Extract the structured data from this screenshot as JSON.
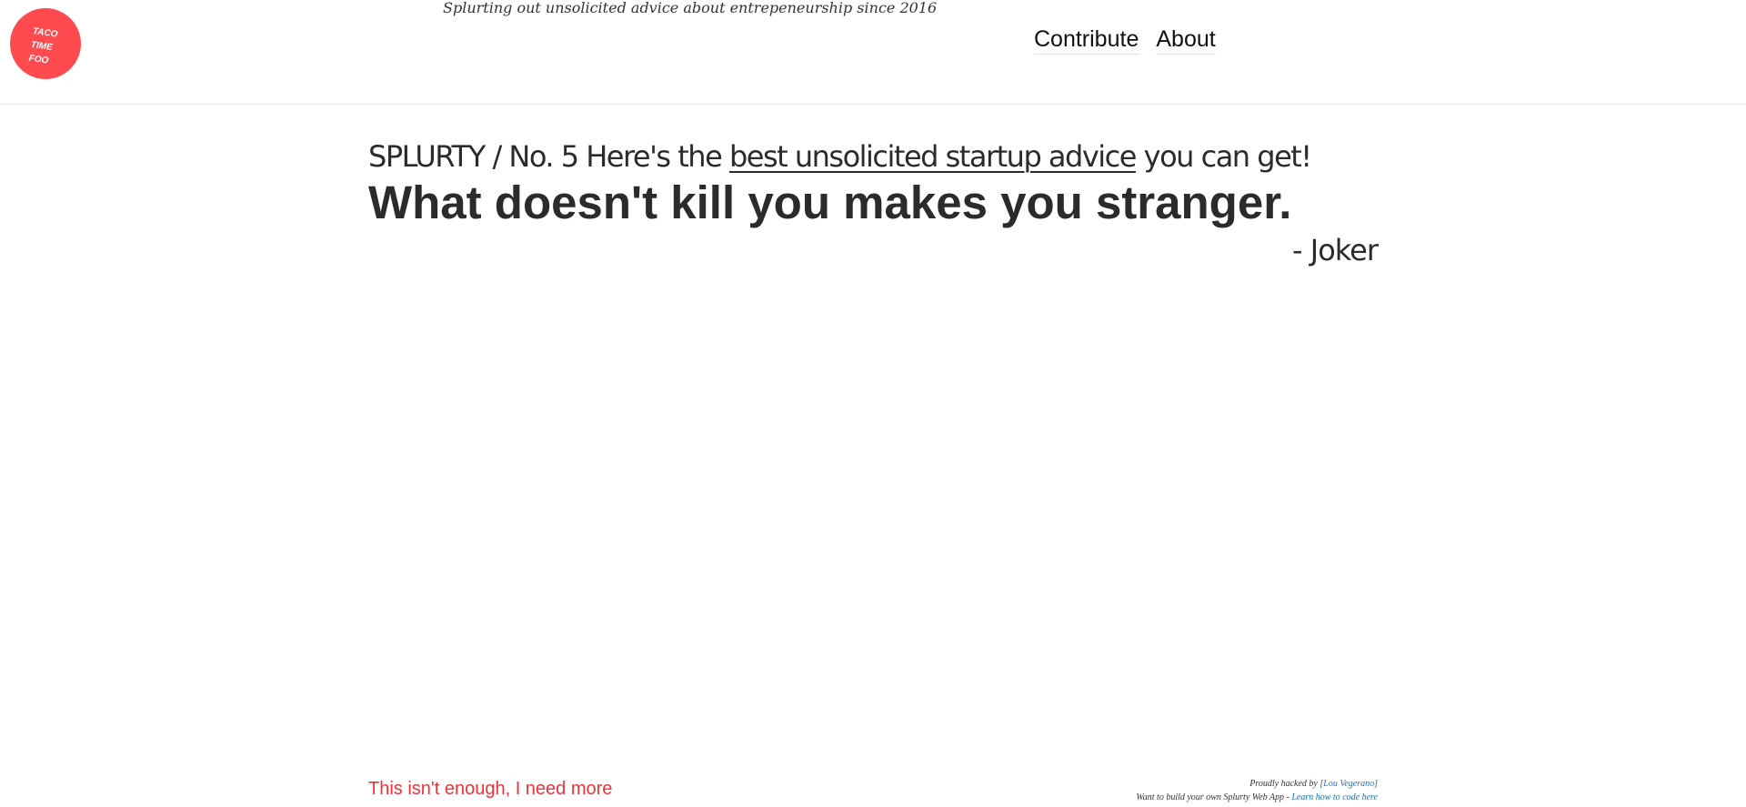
{
  "header": {
    "logo_text": "TACO\nTIME\nFOO",
    "tagline": "Splurting out unsolicited advice about entrepeneurship since 2016",
    "nav": {
      "contribute": "Contribute",
      "about": "About"
    }
  },
  "main": {
    "kicker_prefix": "SPLURTY / No. 5 Here's the ",
    "kicker_link": "best unsolicited startup advice",
    "kicker_suffix": " you can get!",
    "quote": "What doesn't kill you makes you stranger.",
    "author": "- Joker"
  },
  "footer": {
    "more_link": "This isn't enough, I need more",
    "credit_prefix": "Proudly hacked by ",
    "credit_link": "[Lou Vegerano]",
    "build_prefix": "Want to build your own Splurty Web App - ",
    "build_link": "Learn how to code here"
  },
  "colors": {
    "logo_bg": "#ff4a4f",
    "text": "#2b2b2b",
    "more_link": "#f2303a",
    "footer_link": "#1a6fbf"
  }
}
